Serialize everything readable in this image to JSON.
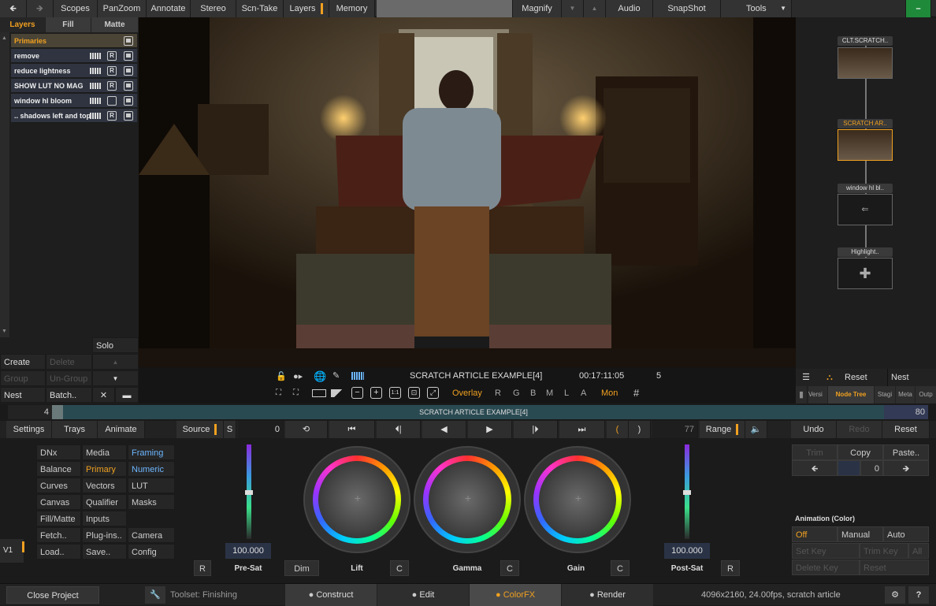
{
  "topbar": {
    "scopes": "Scopes",
    "panzoom": "PanZoom",
    "annotate": "Annotate",
    "stereo": "Stereo",
    "scn_take": "Scn-Take",
    "layers": "Layers",
    "memory": "Memory",
    "magnify": "Magnify",
    "audio": "Audio",
    "snapshot": "SnapShot",
    "tools": "Tools",
    "minimize": "–"
  },
  "left": {
    "tabs": [
      "Layers",
      "Fill",
      "Matte"
    ],
    "primaries": "Primaries",
    "layers": [
      {
        "name": "remove",
        "r": "R"
      },
      {
        "name": "reduce lightness",
        "r": "R"
      },
      {
        "name": "SHOW LUT NO MAG",
        "r": "R"
      },
      {
        "name": "window hl bloom",
        "r": ""
      },
      {
        "name": ".. shadows left and top",
        "r": "R"
      }
    ],
    "solo": "Solo",
    "create": "Create",
    "delete": "Delete",
    "group": "Group",
    "ungroup": "Un-Group",
    "nest": "Nest",
    "batch": "Batch..",
    "close_x": "✕"
  },
  "viewer": {
    "clip_name": "SCRATCH ARTICLE EXAMPLE[4]",
    "timecode": "00:17:11:05",
    "frame": "5",
    "overlay": "Overlay",
    "channels": [
      "R",
      "G",
      "B",
      "M",
      "L",
      "A"
    ],
    "mon": "Mon",
    "ratio": "1:1",
    "grid": "#"
  },
  "nodetree": {
    "nodes": [
      "CLT.SCRATCH..",
      "SCRATCH AR..",
      "window hl bl..",
      "Highlight.."
    ],
    "reset": "Reset",
    "nest": "Nest",
    "tabs": [
      "Versi",
      "Node Tree",
      "Stagi",
      "Meta",
      "Outp"
    ]
  },
  "strip": {
    "left_num": "4",
    "title": "SCRATCH ARTICLE EXAMPLE[4]",
    "right_num": "80"
  },
  "transport": {
    "settings": "Settings",
    "trays": "Trays",
    "animate": "Animate",
    "source": "Source",
    "s": "S",
    "start": "0",
    "end": "77",
    "range": "Range",
    "undo": "Undo",
    "redo": "Redo",
    "reset": "Reset"
  },
  "menu": [
    [
      "DNx",
      "Media",
      "Framing"
    ],
    [
      "Balance",
      "Primary",
      "Numeric"
    ],
    [
      "Curves",
      "Vectors",
      "LUT"
    ],
    [
      "Canvas",
      "Qualifier",
      "Masks"
    ],
    [
      "Fill/Matte",
      "Inputs",
      ""
    ],
    [
      "Fetch..",
      "Plug-ins..",
      "Camera"
    ],
    [
      "Load..",
      "Save..",
      "Config"
    ]
  ],
  "grading": {
    "presat_value": "100.000",
    "postsat_value": "100.000",
    "r": "R",
    "c": "C",
    "dim": "Dim",
    "presat": "Pre-Sat",
    "lift": "Lift",
    "gamma": "Gamma",
    "gain": "Gain",
    "postsat": "Post-Sat",
    "v1": "V1"
  },
  "rightpanel": {
    "trim": "Trim",
    "copy": "Copy",
    "paste": "Paste..",
    "value": "0",
    "animation_title": "Animation (Color)",
    "off": "Off",
    "manual": "Manual",
    "auto": "Auto",
    "set_key": "Set Key",
    "trim_key": "Trim Key",
    "all": "All",
    "delete_key": "Delete Key",
    "reset": "Reset"
  },
  "footer": {
    "close_project": "Close Project",
    "toolset": "Toolset: Finishing",
    "tabs": [
      "Construct",
      "Edit",
      "ColorFX",
      "Render"
    ],
    "info": "4096x2160, 24.00fps, scratch article",
    "help": "?"
  },
  "colors": {
    "accent": "#f0a020",
    "blue": "#6cb6ff",
    "green": "#1f8a3a"
  }
}
